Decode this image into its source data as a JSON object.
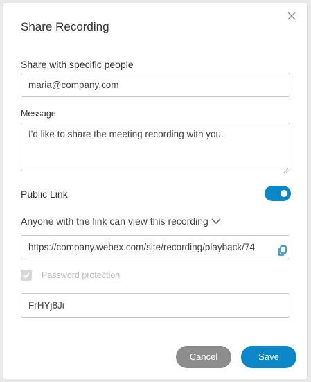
{
  "dialog": {
    "title": "Share Recording",
    "share_label": "Share with specific people",
    "share_value": "maria@company.com",
    "message_label": "Message",
    "message_value": "I'd like to share the meeting recording with you.",
    "public_link_label": "Public Link",
    "public_link_enabled": true,
    "access_option": "Anyone with the link can view this recording",
    "link_value": "https://company.webex.com/site/recording/playback/74",
    "password_protection_label": "Password protection",
    "password_protection_checked": true,
    "password_value": "FrHYj8Ji",
    "cancel_label": "Cancel",
    "save_label": "Save"
  },
  "icons": {
    "close": "close-icon",
    "dropdown": "chevron-down-icon",
    "copy": "copy-icon",
    "check": "check-icon"
  },
  "colors": {
    "accent": "#0b86c8",
    "cancel": "#8c8c8c",
    "disabled_text": "#b8b8b8"
  }
}
